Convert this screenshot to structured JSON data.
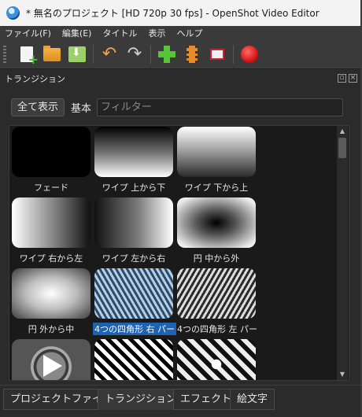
{
  "window": {
    "title": "* 無名のプロジェクト [HD 720p 30 fps] - OpenShot Video Editor"
  },
  "menu": [
    "ファイル(F)",
    "編集(E)",
    "タイトル",
    "表示",
    "ヘルプ"
  ],
  "toolbar": {
    "icons": [
      "new-project-icon",
      "open-folder-icon",
      "save-icon",
      "undo-icon",
      "redo-icon",
      "import-files-icon",
      "add-track-icon",
      "profile-icon",
      "export-video-icon"
    ]
  },
  "dock": {
    "title": "トランジション"
  },
  "filter": {
    "show_all_label": "全て表示",
    "basic_label": "基本",
    "placeholder": "フィルター"
  },
  "transitions": [
    {
      "label": "フェード",
      "style": "t-fade",
      "selected": false
    },
    {
      "label": "ワイプ 上から下",
      "style": "t-wipe-tb",
      "selected": false
    },
    {
      "label": "ワイプ 下から上",
      "style": "t-wipe-bt",
      "selected": false
    },
    {
      "label": "ワイプ 右から左",
      "style": "t-wipe-rl",
      "selected": false
    },
    {
      "label": "ワイプ 左から右",
      "style": "t-wipe-lr",
      "selected": false
    },
    {
      "label": "円 中から外",
      "style": "t-center-out",
      "selected": false
    },
    {
      "label": "円 外から中",
      "style": "t-out-center",
      "selected": false
    },
    {
      "label": "4つの四角形 右 パー",
      "style": "t-squares-r",
      "selected": true
    },
    {
      "label": "4つの四角形 左 パー",
      "style": "t-squares-l",
      "selected": false
    },
    {
      "label": "",
      "style": "t-circle",
      "selected": false
    },
    {
      "label": "",
      "style": "t-diamond1",
      "selected": false
    },
    {
      "label": "",
      "style": "t-diamond2",
      "selected": false
    }
  ],
  "tabs": [
    {
      "label": "プロジェクトファイル",
      "active": false
    },
    {
      "label": "トランジション",
      "active": true
    },
    {
      "label": "エフェクト",
      "active": false
    },
    {
      "label": "絵文字",
      "active": false
    }
  ]
}
